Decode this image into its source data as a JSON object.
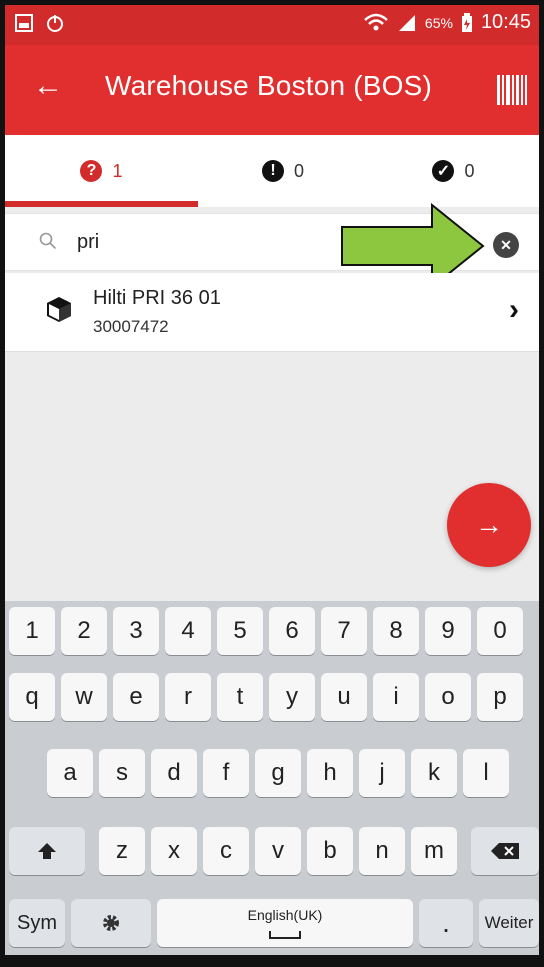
{
  "statusbar": {
    "battery_text": "65%",
    "time": "10:45"
  },
  "appbar": {
    "title": "Warehouse Boston (BOS)"
  },
  "tabs": [
    {
      "icon": "?",
      "count": "1"
    },
    {
      "icon": "!",
      "count": "0"
    },
    {
      "icon": "✓",
      "count": "0"
    }
  ],
  "search": {
    "value": "pri",
    "placeholder": ""
  },
  "list": [
    {
      "name": "Hilti PRI 36 01",
      "code": "30007472"
    }
  ],
  "keyboard": {
    "row1": [
      "1",
      "2",
      "3",
      "4",
      "5",
      "6",
      "7",
      "8",
      "9",
      "0"
    ],
    "row2": [
      "q",
      "w",
      "e",
      "r",
      "t",
      "y",
      "u",
      "i",
      "o",
      "p"
    ],
    "row3": [
      "a",
      "s",
      "d",
      "f",
      "g",
      "h",
      "j",
      "k",
      "l"
    ],
    "row4": [
      "z",
      "x",
      "c",
      "v",
      "b",
      "n",
      "m"
    ],
    "sym": "Sym",
    "space": "English(UK)",
    "period": ".",
    "weiter": "Weiter"
  },
  "colors": {
    "primary": "#e12e2e",
    "statusbar": "#d22b2b",
    "annotation_arrow": "#8dc63f"
  }
}
